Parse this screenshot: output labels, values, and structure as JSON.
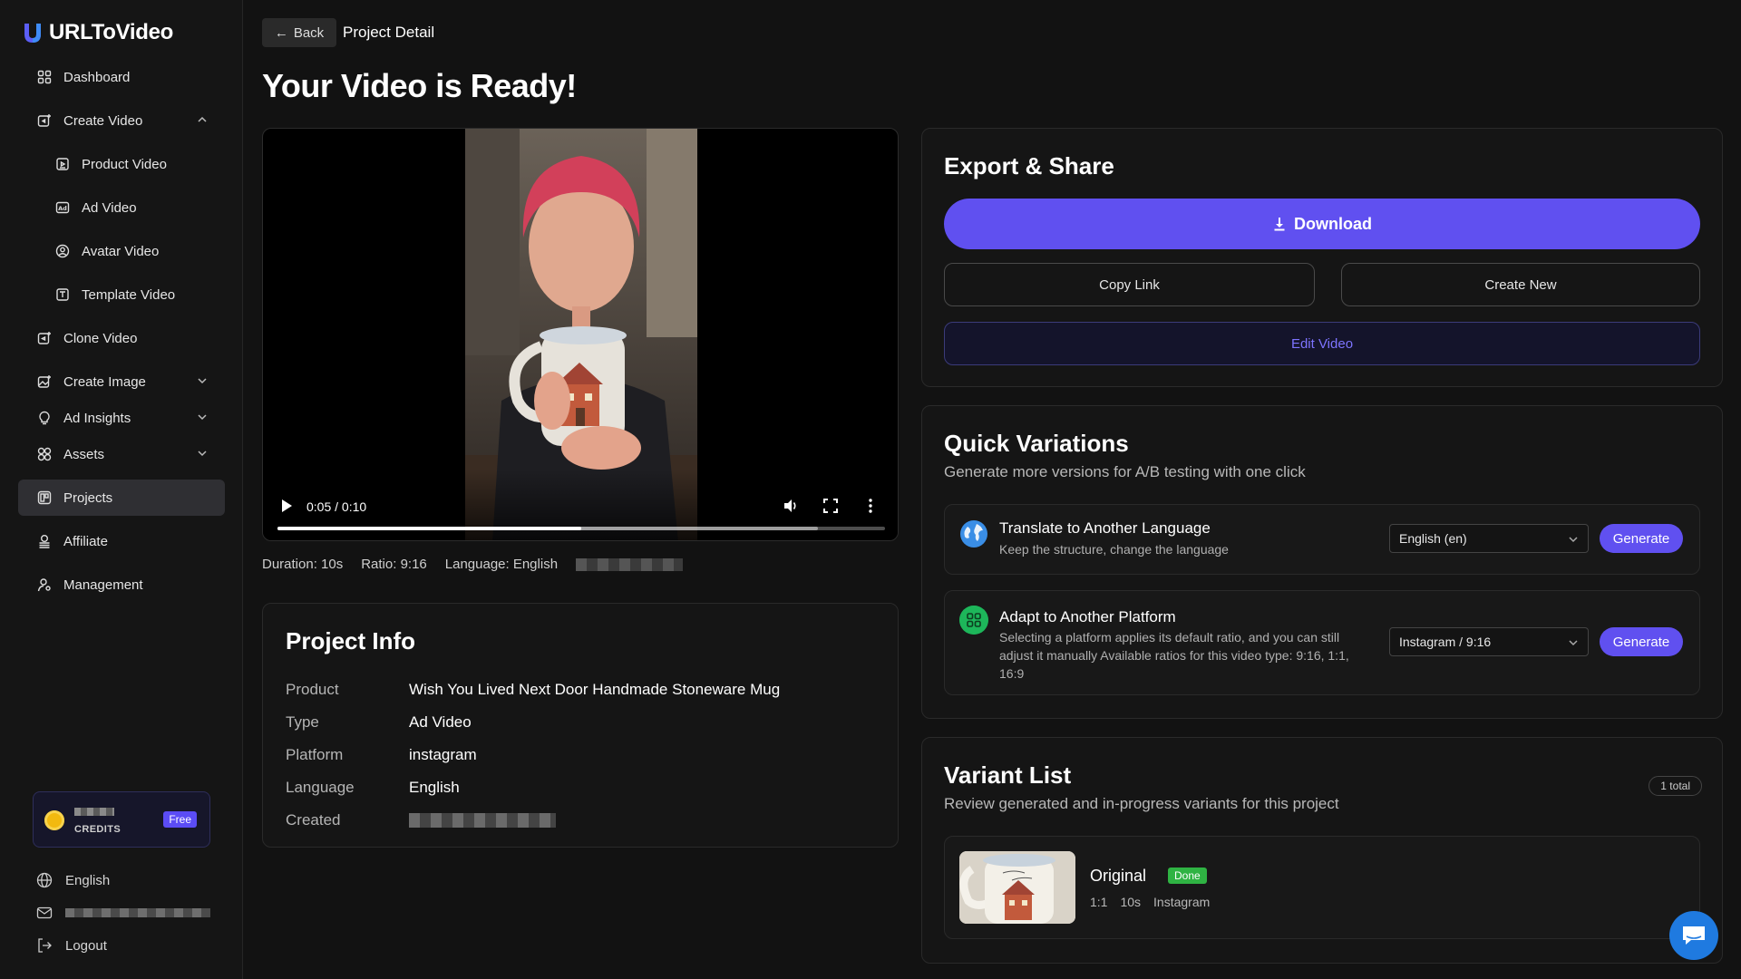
{
  "app": {
    "name": "URLToVideo"
  },
  "sidebar": {
    "items": [
      {
        "label": "Dashboard"
      },
      {
        "label": "Create Video"
      },
      {
        "label": "Product Video"
      },
      {
        "label": "Ad Video"
      },
      {
        "label": "Avatar Video"
      },
      {
        "label": "Template Video"
      },
      {
        "label": "Clone Video"
      },
      {
        "label": "Create Image"
      },
      {
        "label": "Ad Insights"
      },
      {
        "label": "Assets"
      },
      {
        "label": "Projects"
      },
      {
        "label": "Affiliate"
      },
      {
        "label": "Management"
      }
    ],
    "credits": {
      "label": "CREDITS",
      "plan": "Free"
    },
    "language": "English",
    "logout": "Logout"
  },
  "header": {
    "back": "Back",
    "crumb": "Project Detail",
    "title": "Your Video is Ready!"
  },
  "player": {
    "time": "0:05 / 0:10",
    "played_fraction": 0.5,
    "buffered_fraction": 0.89
  },
  "meta": {
    "duration": "Duration: 10s",
    "ratio": "Ratio: 9:16",
    "language": "Language: English"
  },
  "project_info": {
    "title": "Project Info",
    "rows": [
      {
        "k": "Product",
        "v": "Wish You Lived Next Door Handmade Stoneware Mug"
      },
      {
        "k": "Type",
        "v": "Ad Video"
      },
      {
        "k": "Platform",
        "v": "instagram"
      },
      {
        "k": "Language",
        "v": "English"
      },
      {
        "k": "Created",
        "v": ""
      }
    ]
  },
  "export": {
    "title": "Export & Share",
    "download": "Download",
    "copy_link": "Copy Link",
    "create_new": "Create New",
    "edit_video": "Edit Video"
  },
  "quick": {
    "title": "Quick Variations",
    "subtitle": "Generate more versions for A/B testing with one click",
    "translate": {
      "title": "Translate to Another Language",
      "desc": "Keep the structure, change the language",
      "selected": "English (en)",
      "button": "Generate"
    },
    "adapt": {
      "title": "Adapt to Another Platform",
      "desc": "Selecting a platform applies its default ratio, and you can still adjust it manually Available ratios for this video type: 9:16, 1:1, 16:9",
      "selected": "Instagram / 9:16",
      "button": "Generate"
    }
  },
  "variants": {
    "title": "Variant List",
    "subtitle": "Review generated and in-progress variants for this project",
    "total": "1 total",
    "items": [
      {
        "name": "Original",
        "status": "Done",
        "ratio": "1:1",
        "duration": "10s",
        "platform": "Instagram"
      }
    ]
  },
  "colors": {
    "accent": "#6050f0",
    "success": "#2fb343",
    "chat": "#1f7ae0"
  }
}
